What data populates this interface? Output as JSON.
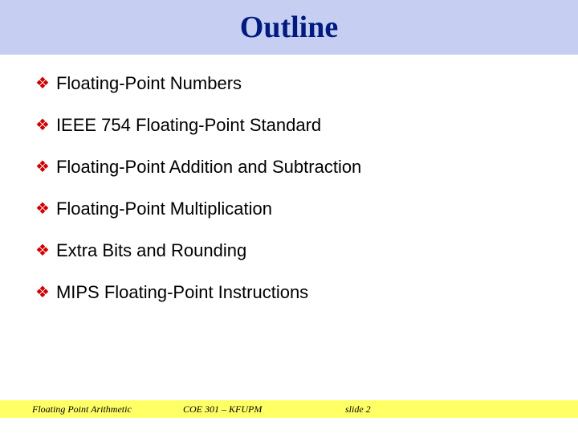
{
  "title": "Outline",
  "bullets": [
    "Floating-Point Numbers",
    "IEEE 754 Floating-Point Standard",
    "Floating-Point Addition and Subtraction",
    "Floating-Point Multiplication",
    "Extra Bits and Rounding",
    "MIPS Floating-Point Instructions"
  ],
  "footer": {
    "left": "Floating Point Arithmetic",
    "center": "COE 301 – KFUPM",
    "right": "slide 2"
  }
}
